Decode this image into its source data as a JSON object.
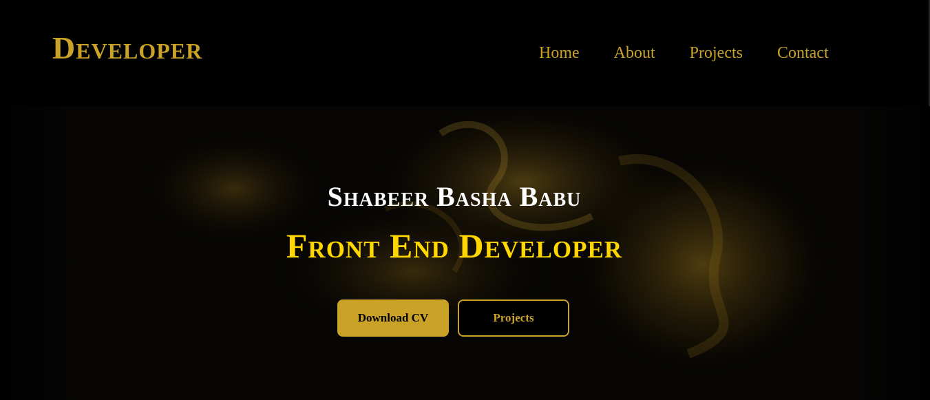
{
  "brand": {
    "logo": "Developer"
  },
  "nav": {
    "items": [
      {
        "label": "Home"
      },
      {
        "label": "About"
      },
      {
        "label": "Projects"
      },
      {
        "label": "Contact"
      }
    ]
  },
  "hero": {
    "name": "Shabeer Basha Babu",
    "title": "Front End Developer",
    "primary_button": "Download CV",
    "secondary_button": "Projects"
  },
  "colors": {
    "accent": "#c9a227",
    "title": "#ffd700",
    "background": "#000000",
    "text": "#ffffff"
  }
}
